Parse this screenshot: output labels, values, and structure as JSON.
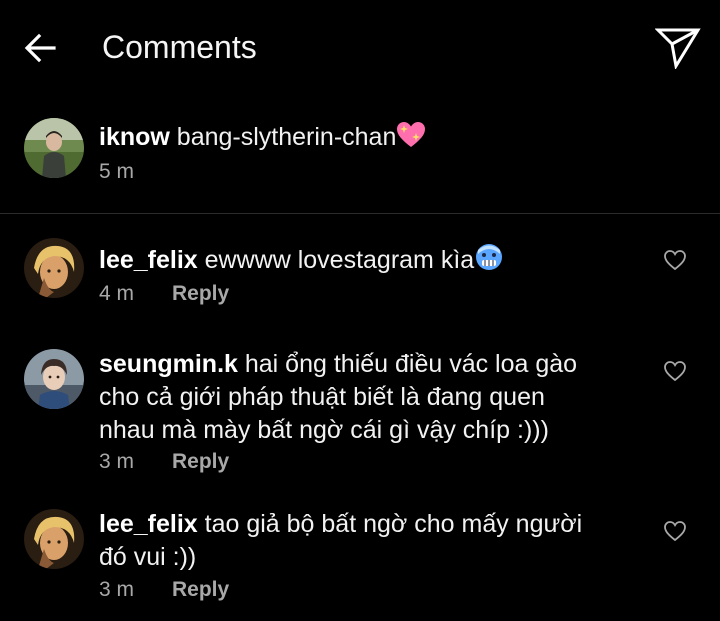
{
  "header": {
    "title": "Comments"
  },
  "caption": {
    "username": "iknow",
    "text": "bang-slytherin-chan",
    "emoji": "sparkling-heart",
    "time": "5 m"
  },
  "comments": [
    {
      "username": "lee_felix",
      "text": "ewwww lovestagram kìa",
      "emoji": "cold-face",
      "time": "4 m",
      "reply_label": "Reply"
    },
    {
      "username": "seungmin.k",
      "text_line1": "hai ổng thiếu điều vác loa gào",
      "text_line2": "cho cả giới pháp thuật biết là đang quen",
      "text_line3": "nhau mà mày bất ngờ cái gì vậy chíp :)))",
      "time": "3 m",
      "reply_label": "Reply"
    },
    {
      "username": "lee_felix",
      "text_line1": "tao giả bộ bất ngờ cho mấy người",
      "text_line2": "đó vui :))",
      "time": "3 m",
      "reply_label": "Reply"
    }
  ],
  "colors": {
    "background": "#000000",
    "text": "#ffffff",
    "muted": "#a8a8a8",
    "divider": "#2b2b2b"
  }
}
